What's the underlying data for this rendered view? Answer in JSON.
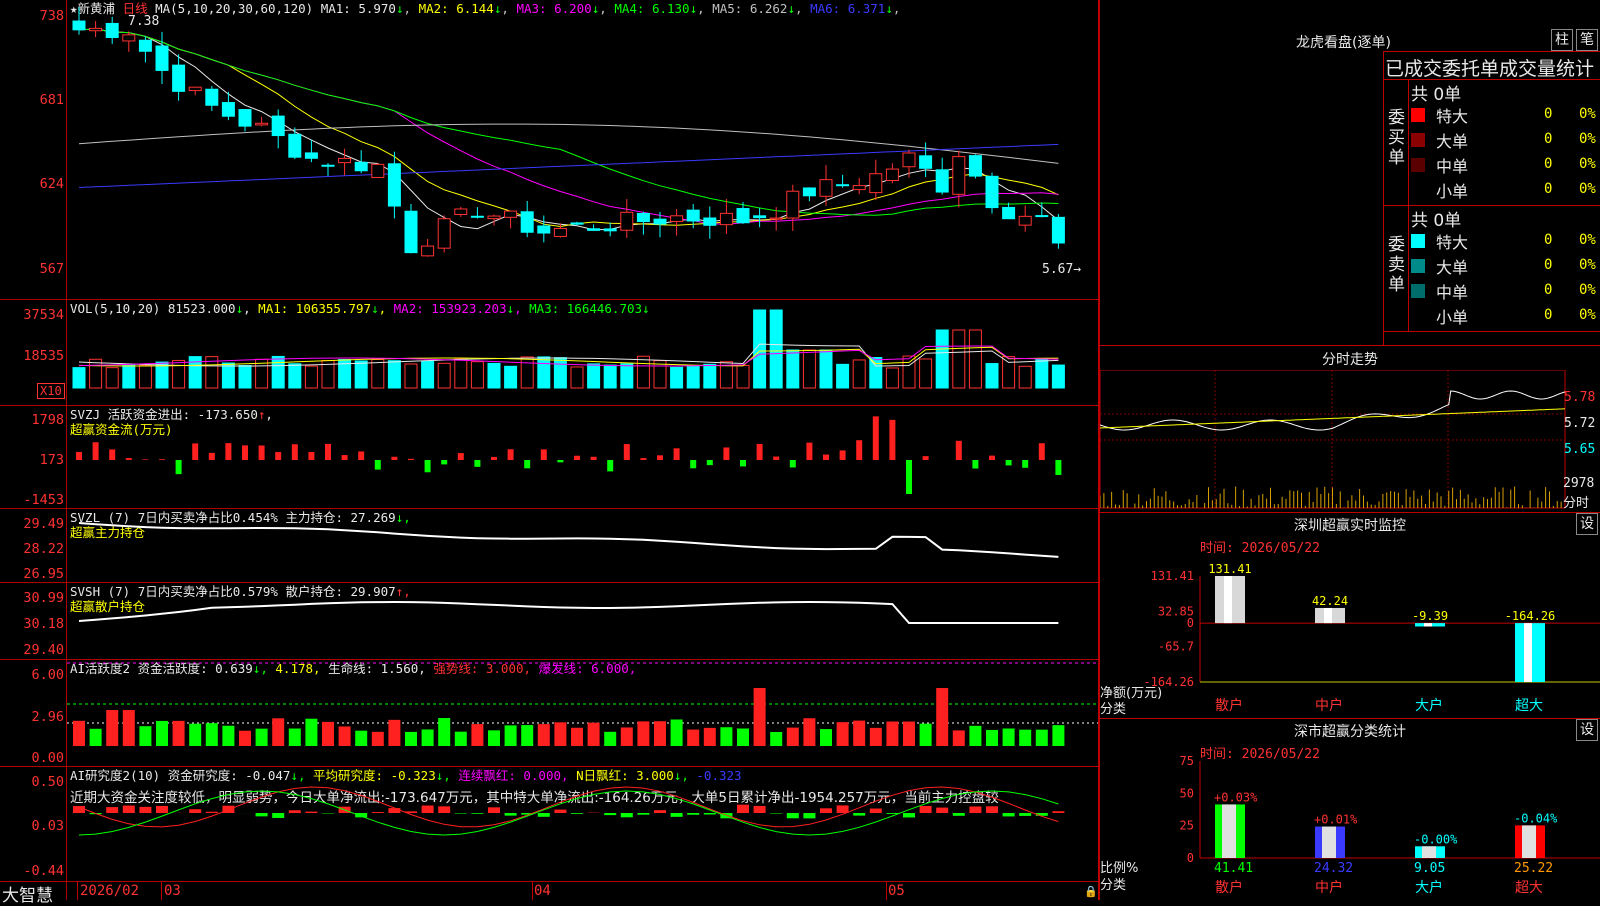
{
  "stock": {
    "name": "★新黄浦",
    "period": "日线"
  },
  "main": {
    "ma_title": "MA(5,10,20,30,60,120)",
    "ma": [
      {
        "label": "MA1:",
        "value": "5.970",
        "arrow": "↓",
        "color": "#e8e8e8"
      },
      {
        "label": "MA2:",
        "value": "6.144",
        "arrow": "↓",
        "color": "#ffff00"
      },
      {
        "label": "MA3:",
        "value": "6.200",
        "arrow": "↓",
        "color": "#ff00ff"
      },
      {
        "label": "MA4:",
        "value": "6.130",
        "arrow": "↓",
        "color": "#00ff00"
      },
      {
        "label": "MA5:",
        "value": "6.262",
        "arrow": "↓",
        "color": "#c0c0c0"
      },
      {
        "label": "MA6:",
        "value": "6.371",
        "arrow": "↓",
        "color": "#3a3aff"
      }
    ],
    "yaxis": [
      "738",
      "681",
      "624",
      "567"
    ],
    "high_mark": "7.38",
    "low_mark": "5.67→"
  },
  "vol": {
    "title": "VOL(5,10,20)",
    "value": "81523.000",
    "ma1": "MA1: 106355.797",
    "ma2": "MA2: 153923.203",
    "ma3": "MA3: 166446.703",
    "arrow": "↓",
    "yaxis": [
      "37534",
      "18535"
    ],
    "unit": "X10"
  },
  "svzj": {
    "title": "SVZJ  活跃资金进出: -173.650",
    "arrow": "↑",
    "sub": "超赢资金流(万元)",
    "yaxis": [
      "1798",
      "173",
      "-1453"
    ]
  },
  "svzl": {
    "title": "SVZL (7) 7日内买卖净占比0.454%",
    "hold": "主力持仓: 27.269",
    "arrow": "↓,",
    "sub": "超赢主力持仓",
    "yaxis": [
      "29.49",
      "28.22",
      "26.95"
    ]
  },
  "svsh": {
    "title": "SVSH (7) 7日内买卖净占比0.579%",
    "hold": "散户持仓: 29.907",
    "arrow": "↑,",
    "sub": "超赢散户持仓",
    "yaxis": [
      "30.99",
      "30.18",
      "29.40"
    ]
  },
  "ai_active": {
    "title": "AI活跃度2 资金活跃度: 0.639",
    "v2": "4.178,",
    "life": "生命线: 1.560,",
    "strong": "强势线: 3.000,",
    "burst": "爆发线: 6.000,",
    "arrow": "↓,",
    "yaxis": [
      "6.00",
      "2.96",
      "0.00"
    ]
  },
  "ai_research": {
    "title": "AI研究度2(10) 资金研究度: -0.047",
    "avg": "平均研究度: -0.323",
    "streak": "连续飘红: 0.000,",
    "nday": "N日飘红: 3.000",
    "last": "-0.323",
    "arrow": "↓,",
    "comment": "近期大资金关注度较低，明显弱势，今日大单净流出:-173.647万元，其中特大单净流出:-164.26万元，大单5日累计净出-1954.257万元，当前主力控盘较",
    "yaxis": [
      "0.50",
      "0.03",
      "-0.44"
    ]
  },
  "xaxis": {
    "labels": [
      "2026/02",
      "03",
      "04",
      "05"
    ]
  },
  "brand": "大智慧",
  "lhb": {
    "title": "龙虎看盘(逐单)",
    "btn1": "柱",
    "btn2": "笔",
    "header": "已成交委托单成交量统计",
    "buy_group": "委买单",
    "sell_group": "委卖单",
    "buy_total": "共 0单",
    "sell_total": "共 0单",
    "rows_buy": [
      {
        "name": "特大",
        "qty": "0",
        "pct": "0%",
        "color": "#ff0000"
      },
      {
        "name": "大单",
        "qty": "0",
        "pct": "0%",
        "color": "#8b0000"
      },
      {
        "name": "中单",
        "qty": "0",
        "pct": "0%",
        "color": "#5a0000"
      },
      {
        "name": "小单",
        "qty": "0",
        "pct": "0%",
        "color": ""
      }
    ],
    "rows_sell": [
      {
        "name": "特大",
        "qty": "0",
        "pct": "0%",
        "color": "#00ffff"
      },
      {
        "name": "大单",
        "qty": "0",
        "pct": "0%",
        "color": "#008b8b"
      },
      {
        "name": "中单",
        "qty": "0",
        "pct": "0%",
        "color": "#006d6d"
      },
      {
        "name": "小单",
        "qty": "0",
        "pct": "0%",
        "color": ""
      }
    ]
  },
  "intraday": {
    "title": "分时走势",
    "yaxis": [
      "5.78",
      "5.72",
      "5.65"
    ],
    "vol_label": "2978",
    "vol_sub": "分时"
  },
  "monitor": {
    "title": "深圳超赢实时监控",
    "settings": "设",
    "time": "时间: 2026/05/22",
    "yaxis": [
      "131.41",
      "32.85",
      "0",
      "-65.7",
      "-164.26"
    ],
    "ylabel": "净额(万元)",
    "xlabel": "分类",
    "bars": [
      {
        "cat": "散户",
        "value": 131.41,
        "label": "131.41"
      },
      {
        "cat": "中户",
        "value": 42.24,
        "label": "42.24"
      },
      {
        "cat": "大户",
        "value": -9.39,
        "label": "-9.39"
      },
      {
        "cat": "超大",
        "value": -164.26,
        "label": "-164.26"
      }
    ]
  },
  "classify": {
    "title": "深市超赢分类统计",
    "settings": "设",
    "time": "时间: 2026/05/22",
    "yaxis": [
      "75",
      "50",
      "25",
      "0"
    ],
    "ylabel": "比例%",
    "xlabel": "分类",
    "bars": [
      {
        "cat": "散户",
        "value": 41.41,
        "label": "41.41",
        "delta": "+0.03%",
        "color": "#e0e0e0",
        "accent": "#00ff00"
      },
      {
        "cat": "中户",
        "value": 24.32,
        "label": "24.32",
        "delta": "+0.01%",
        "color": "#e0e0e0",
        "accent": "#3a3aff"
      },
      {
        "cat": "大户",
        "value": 9.05,
        "label": "9.05",
        "delta": "-0.00%",
        "color": "#e0e0e0",
        "accent": "#00ffff"
      },
      {
        "cat": "超大",
        "value": 25.22,
        "label": "25.22",
        "delta": "-0.04%",
        "color": "#e0e0e0",
        "accent": "#ff0000"
      }
    ]
  },
  "colors": {
    "up": "#ff3232",
    "down": "#00ffff",
    "grid": "#b00000"
  }
}
